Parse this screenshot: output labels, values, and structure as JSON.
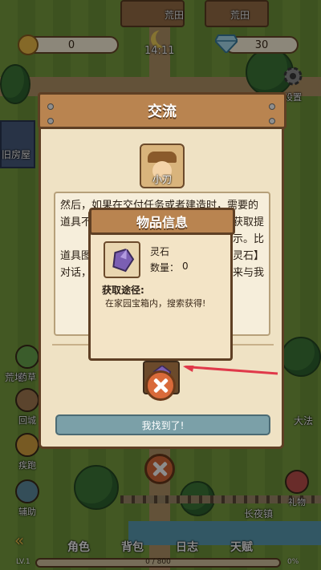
{
  "hud": {
    "coins": "0",
    "diamonds": "30",
    "clock": "14:11",
    "settings_label": "设置"
  },
  "map_labels": {
    "field_left": "荒田",
    "field_right": "荒田",
    "old_house": "旧房屋",
    "wasteland": "荒地",
    "street": "长夜镇",
    "dafa": "大法",
    "gift": "礼物"
  },
  "side_left": [
    {
      "label": "药草",
      "count": "0"
    },
    {
      "label": "回城",
      "count": "0"
    },
    {
      "label": "疾跑"
    },
    {
      "label": "辅助"
    }
  ],
  "panel": {
    "title": "交流",
    "npc_name": "小刀",
    "dialog_lines": [
      "然后，如果在交付任务或者建造时，需要的",
      "道具不",
      "道具图",
      "对话，"
    ],
    "dialog_right_fragments": [
      "获取提",
      "示。比",
      "灵石】",
      "来与我"
    ],
    "found_button": "我找到了!"
  },
  "item_popup": {
    "title": "物品信息",
    "item_name": "灵石",
    "count_label": "数量：",
    "count_value": "0",
    "obtain_title": "获取途径:",
    "obtain_desc": "在家园宝箱内，搜索获得!"
  },
  "bottom": {
    "tabs": [
      "角色",
      "背包",
      "日志",
      "天赋"
    ],
    "level": "LV.1",
    "exp": "0 / 800",
    "percent": "0%",
    "exp_fraction": 0
  },
  "colors": {
    "accent": "#b98450",
    "close": "#d96a3a",
    "arrow": "#e0394a"
  }
}
